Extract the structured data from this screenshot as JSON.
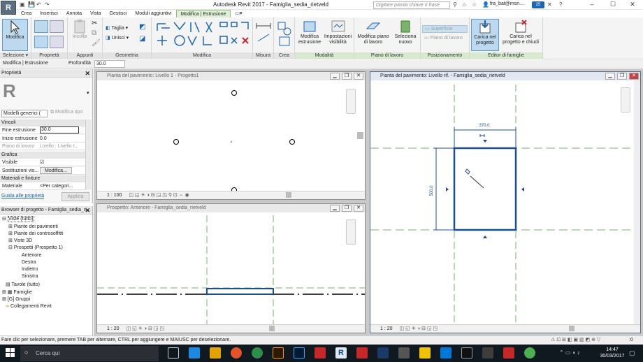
{
  "titlebar": {
    "app_letter": "R",
    "title": "Autodesk Revit 2017 -     Famiglia_sedia_rietveld",
    "search_placeholder": "Digitare parola chiave o frase",
    "user": "fra_bat@msn....",
    "badge": "25",
    "minimize": "–",
    "maximize": "☐",
    "close": "✕"
  },
  "tabs": [
    "Crea",
    "Inserisci",
    "Annota",
    "Vista",
    "Gestisci",
    "Moduli aggiuntivi",
    "Modifica | Estrusione"
  ],
  "active_tab_index": 6,
  "ribbon": {
    "modifica_label": "Modifica",
    "incolla_label": "Incolla",
    "taglia_label": "Taglia",
    "unisci_label": "Unisci",
    "modifica_estrusione_label": "Modifica estrusione",
    "impostazioni_visibilita_label": "Impostazioni visibilità",
    "modifica_piano_label": "Modifica piano di lavoro",
    "seleziona_nuovo_label": "Seleziona nuovo",
    "superficie_label": "Superficie",
    "piano_di_lavoro_label": "Piano di lavoro",
    "carica_progetto_label": "Carica nel progetto",
    "carica_chiudi_label": "Carica nel progetto e chiudi",
    "panels": {
      "selezione": "Selezione ▾",
      "proprieta": "Proprietà",
      "appunti": "Appunti",
      "geometria": "Geometria",
      "modifica": "Modifica",
      "misura": "Misura",
      "crea": "Crea",
      "modalita": "Modalità",
      "piano": "Piano di lavoro",
      "posizionamento": "Posizionamento",
      "editor": "Editor di famiglie"
    }
  },
  "options_bar": {
    "context": "Modifica | Estrusione",
    "depth_label": "Profondità",
    "depth_value": "30.0"
  },
  "properties": {
    "title": "Proprietà",
    "type_selector": "Modelli generici (",
    "edit_type": "Modifica tipo",
    "sections": {
      "vincoli": "Vincoli",
      "grafica": "Grafica",
      "materiali": "Materiali e finiture"
    },
    "rows": {
      "fine_estrusione": {
        "key": "Fine estrusione",
        "value": "30.0"
      },
      "inizio_estrusione": {
        "key": "Inizio estrusione",
        "value": "0.0"
      },
      "piano_di_lavoro": {
        "key": "Piano di lavoro",
        "value": "Livello : Livello r..."
      },
      "visibile": {
        "key": "Visibile",
        "value": "☑"
      },
      "sostituzioni": {
        "key": "Sostituzioni vis...",
        "value": "Modifica..."
      },
      "materiale": {
        "key": "Materiale",
        "value": "<Per categori..."
      }
    },
    "help_link": "Guida alle proprietà",
    "apply": "Applica"
  },
  "browser": {
    "title": "Browser di progetto - Famiglia_sedia_ri...",
    "items": [
      "Viste (tutto)",
      "Piante dei pavimenti",
      "Piante dei controsoffitti",
      "Viste 3D",
      "Prospetti (Prospetto 1)",
      "Anteriore",
      "Destra",
      "Indietro",
      "Sinistra",
      "Tavole (tutto)",
      "Famiglie",
      "Gruppi",
      "Collegamenti Revit"
    ]
  },
  "views": {
    "plan1": {
      "title": "Pianta del pavimento: Livello 1 - Progetto1",
      "scale": "1 : 100"
    },
    "elev": {
      "title": "Prospetto: Anteriore - Famiglia_sedia_rietveld",
      "scale": "1 : 20"
    },
    "plan2": {
      "title": "Pianta del pavimento: Livello rif. - Famiglia_sedia_rietveld",
      "scale": "1 : 20"
    }
  },
  "dimensions": {
    "width": "370.0",
    "height": "500.0"
  },
  "status_text": "Fare clic per selezionare, premere TAB per alternare, CTRL per aggiungere e MAIUSC per deselezionare.",
  "status_right": ":0",
  "taskbar": {
    "search": "Cerca qui",
    "time": "14:47",
    "date": "30/03/2017"
  },
  "colors": {
    "sketch_blue": "#1f4e8c",
    "ref_green": "#6fb76f",
    "ribbon_active": "#dff0d7"
  }
}
